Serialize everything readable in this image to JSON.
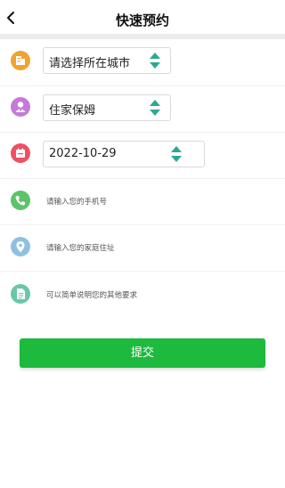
{
  "header": {
    "title": "快速预约"
  },
  "form": {
    "city": {
      "value": "请选择所在城市",
      "icon": "building-icon",
      "icon_color": "#f0a331"
    },
    "service": {
      "value": "住家保姆",
      "icon": "caregiver-icon",
      "icon_color": "#c57ad8"
    },
    "date": {
      "value": "2022-10-29",
      "icon": "calendar-icon",
      "icon_color": "#ef4f64"
    },
    "phone": {
      "placeholder": "请输入您的手机号",
      "icon": "phone-icon",
      "icon_color": "#5cc468"
    },
    "address": {
      "placeholder": "请输入您的家庭住址",
      "icon": "location-pin-icon",
      "icon_color": "#8ec1df"
    },
    "notes": {
      "placeholder": "可以简单说明您的其他要求",
      "icon": "document-icon",
      "icon_color": "#68c7a9"
    }
  },
  "actions": {
    "submit_label": "提交"
  },
  "colors": {
    "accent_green": "#1dba3e",
    "stepper_teal": "#2aa893"
  }
}
